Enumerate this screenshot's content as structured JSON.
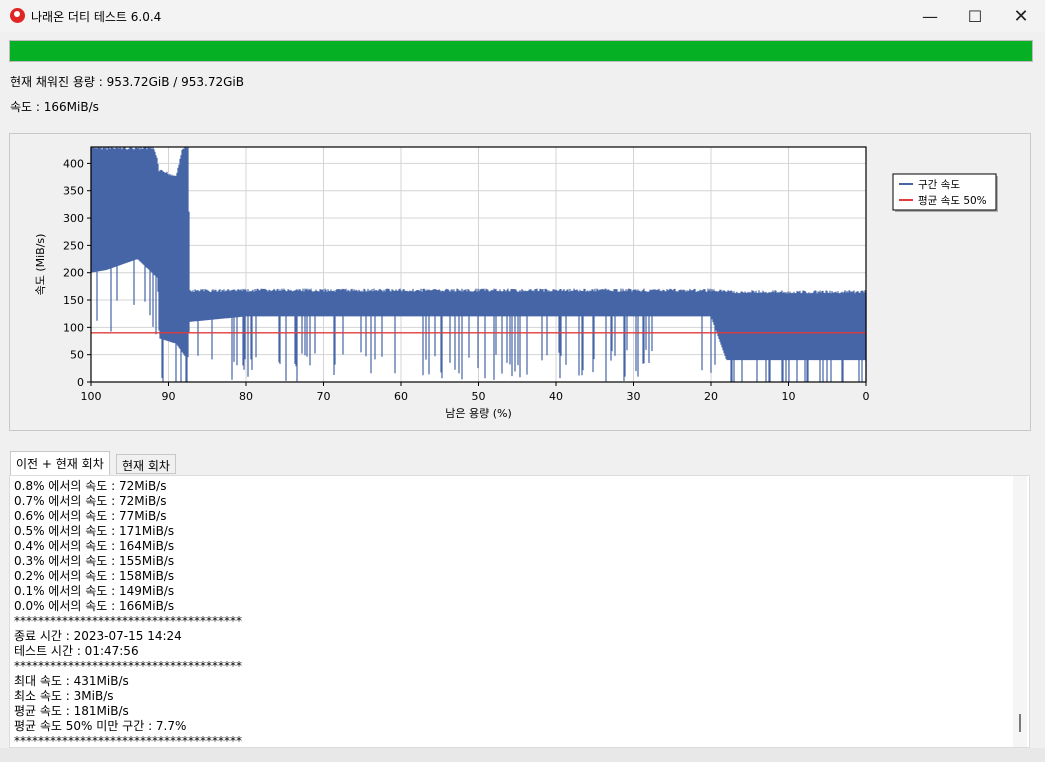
{
  "window": {
    "title": "나래온 더티 테스트 6.0.4"
  },
  "controls": {
    "minimize": "—",
    "maximize": "☐",
    "close": "✕"
  },
  "progress": {
    "percent": 100,
    "color": "#06b025"
  },
  "info": {
    "filled": "현재 채워진 용량 : 953.72GiB / 953.72GiB",
    "speed": "속도 : 166MiB/s"
  },
  "chart_data": {
    "type": "line",
    "xlabel": "남은 용량 (%)",
    "ylabel": "속도 (MiB/s)",
    "xlim": [
      100,
      0
    ],
    "ylim": [
      0,
      430
    ],
    "x_ticks": [
      100,
      90,
      80,
      70,
      60,
      50,
      40,
      30,
      20,
      10,
      0
    ],
    "y_ticks": [
      0,
      50,
      100,
      150,
      200,
      250,
      300,
      350,
      400
    ],
    "grid": true,
    "legend_position": "right",
    "series": [
      {
        "name": "구간 속도",
        "color": "#4565a6",
        "upper_x": [
          100,
          96,
          94,
          92,
          91.4,
          91.3,
          89,
          88.2,
          87.4,
          87.3,
          80,
          60,
          40,
          20,
          18,
          10,
          0
        ],
        "upper_y": [
          431,
          431,
          431,
          431,
          410,
          390,
          380,
          431,
          431,
          170,
          171,
          171,
          171,
          171,
          168,
          168,
          168
        ],
        "lower_x": [
          100,
          98,
          96,
          94,
          92.5,
          91.4,
          91.2,
          89,
          87.5,
          87.3,
          80,
          60,
          40,
          20,
          18,
          10,
          0
        ],
        "lower_y": [
          200,
          205,
          215,
          225,
          205,
          190,
          80,
          70,
          40,
          110,
          120,
          120,
          120,
          120,
          40,
          40,
          40
        ]
      },
      {
        "name": "평균 속도 50%",
        "color": "#e03c3c",
        "y": 90
      }
    ]
  },
  "tabs": [
    {
      "label": "이전 + 현재 회차"
    },
    {
      "label": "현재 회차"
    }
  ],
  "log": {
    "lines": [
      "0.8% 에서의 속도 : 72MiB/s",
      "0.7% 에서의 속도 : 72MiB/s",
      "0.6% 에서의 속도 : 77MiB/s",
      "0.5% 에서의 속도 : 171MiB/s",
      "0.4% 에서의 속도 : 164MiB/s",
      "0.3% 에서의 속도 : 155MiB/s",
      "0.2% 에서의 속도 : 158MiB/s",
      "0.1% 에서의 속도 : 149MiB/s",
      "0.0% 에서의 속도 : 166MiB/s",
      "**************************************",
      "종료 시간 : 2023-07-15 14:24",
      "테스트 시간 : 01:47:56",
      "**************************************",
      "최대 속도 : 431MiB/s",
      "최소 속도 : 3MiB/s",
      "평균 속도 : 181MiB/s",
      "평균 속도 50% 미만 구간 : 7.7%",
      "**************************************"
    ]
  }
}
